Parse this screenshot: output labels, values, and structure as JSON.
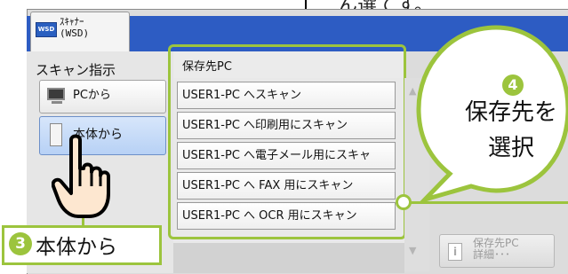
{
  "top_callout": {
    "text": "ん選てす。"
  },
  "app": {
    "title": "ｽｷｬﾅｰ\n(WSD)",
    "icon_label": "WSD"
  },
  "left_panel": {
    "title": "スキャン指示",
    "buttons": [
      {
        "label": "PCから"
      },
      {
        "label": "本体から"
      }
    ]
  },
  "destination": {
    "header": "保存先PC",
    "items": [
      {
        "label": "USER1-PC へスキャン"
      },
      {
        "label": "USER1-PC へ印刷用にスキャン"
      },
      {
        "label": "USER1-PC へ電子メール用にスキャ"
      },
      {
        "label": "USER1-PC へ FAX 用にスキャン"
      },
      {
        "label": "USER1-PC へ OCR 用にスキャン"
      }
    ]
  },
  "scroll": {
    "up": "▲",
    "down": "▼"
  },
  "detail_button": {
    "label": "保存先PC\n詳細･･･",
    "icon": "i"
  },
  "step3": {
    "number": "3",
    "text": "本体から"
  },
  "step4": {
    "number": "4",
    "text": "保存先を\n選択"
  },
  "colors": {
    "accent_green": "#9cc43d",
    "header_blue": "#2d5cc3",
    "selected_blue": "#b7d1f5"
  }
}
